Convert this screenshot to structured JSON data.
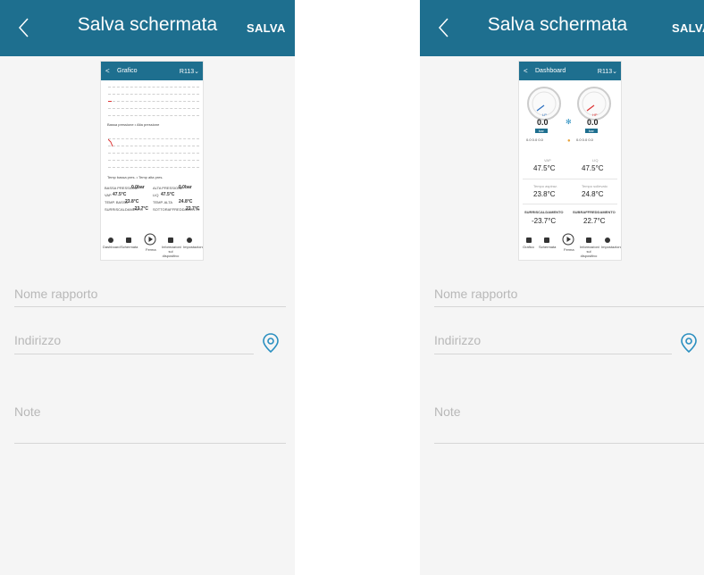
{
  "left": {
    "header": {
      "title": "Salva schermata",
      "save_label": "SALVA"
    },
    "thumbnail": {
      "header_title": "Grafico",
      "refrigerant": "R113",
      "legend_1": "Bassa pressione  •  Alta pressione",
      "legend_2": "Temp bassa pres.  •  Temp alta pres.",
      "readings": [
        {
          "label": "BASSA PRESSIONE",
          "value": "0.0bar"
        },
        {
          "label": "ALTA PRESSIONE",
          "value": "0.0bar"
        },
        {
          "label": "VAP",
          "value": "47.5°C"
        },
        {
          "label": "LIQ",
          "value": "47.5°C"
        },
        {
          "label": "TEMP. BASSA",
          "value": "23.8°C"
        },
        {
          "label": "TEMP. ALTA",
          "value": "24.8°C"
        },
        {
          "label": "SURRISCALDAMENTO",
          "value": "-23.7°C"
        },
        {
          "label": "SOTTORAFFREDDAMENTO",
          "value": "22.7°C"
        }
      ],
      "nav": [
        "Dashboard",
        "Schermata",
        "Ferma",
        "Informazioni sul dispositivo",
        "Impostazioni"
      ]
    },
    "fields": {
      "name_placeholder": "Nome rapporto",
      "address_placeholder": "Indirizzo",
      "notes_placeholder": "Note"
    }
  },
  "right": {
    "header": {
      "title": "Salva schermata",
      "save_label": "SALVA"
    },
    "thumbnail": {
      "header_title": "Dashboard",
      "refrigerant": "R113",
      "lp_label": "LP",
      "hp_label": "HP",
      "lp_value": "0.0",
      "hp_value": "0.0",
      "unit": "bar",
      "vap_label": "VAP",
      "liq_label": "LIQ",
      "vap_value": "47.5°C",
      "liq_value": "47.5°C",
      "temp_low_label": "Tempo aspiraz.",
      "temp_high_label": "Tempo sollevato",
      "temp_low_value": "23.8°C",
      "temp_high_value": "24.8°C",
      "superheat_label": "SURRISCALDAMENTO",
      "subcool_label": "SUBRAFFREDDAMENTO",
      "superheat_value": "-23.7°C",
      "subcool_value": "22.7°C",
      "nav": [
        "Grafico",
        "Schermata",
        "Ferma",
        "Informazioni sul dispositivo",
        "Impostazioni"
      ]
    },
    "fields": {
      "name_placeholder": "Nome rapporto",
      "address_placeholder": "Indirizzo",
      "notes_placeholder": "Note"
    }
  },
  "colors": {
    "header": "#1e6f8f",
    "accent": "#2a8fc0",
    "background": "#f5f5f5"
  }
}
